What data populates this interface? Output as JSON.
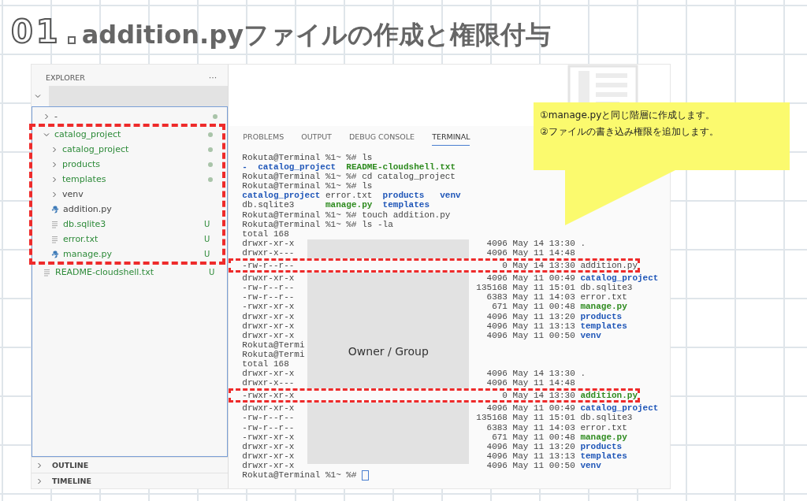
{
  "title": {
    "number": "01",
    "text": "addition.pyファイルの作成と権限付与"
  },
  "explorer": {
    "title": "EXPLORER",
    "more": "···",
    "tree": [
      {
        "name": "-",
        "kind": "folder",
        "expanded": false,
        "untracked": false,
        "dot": true
      },
      {
        "name": "catalog_project",
        "kind": "folder",
        "expanded": true,
        "untracked": true,
        "dot": true,
        "highlighted": true,
        "children": [
          {
            "name": "catalog_project",
            "kind": "folder",
            "expanded": false,
            "untracked": true,
            "dot": true
          },
          {
            "name": "products",
            "kind": "folder",
            "expanded": false,
            "untracked": true,
            "dot": true
          },
          {
            "name": "templates",
            "kind": "folder",
            "expanded": false,
            "untracked": true,
            "dot": true
          },
          {
            "name": "venv",
            "kind": "folder",
            "expanded": false,
            "untracked": false,
            "dot": false
          },
          {
            "name": "addition.py",
            "kind": "python",
            "untracked": false,
            "dot": false
          },
          {
            "name": "db.sqlite3",
            "kind": "text",
            "untracked": true,
            "dot": false,
            "badge": "U"
          },
          {
            "name": "error.txt",
            "kind": "text",
            "untracked": true,
            "dot": false,
            "badge": "U"
          },
          {
            "name": "manage.py",
            "kind": "python",
            "untracked": true,
            "dot": false,
            "badge": "U"
          }
        ]
      },
      {
        "name": "README-cloudshell.txt",
        "kind": "text",
        "untracked": true,
        "dot": false,
        "badge": "U"
      }
    ],
    "sections": [
      {
        "label": "OUTLINE",
        "expanded": false
      },
      {
        "label": "TIMELINE",
        "expanded": false
      }
    ]
  },
  "panel_tabs": [
    {
      "label": "PROBLEMS",
      "selected": false
    },
    {
      "label": "OUTPUT",
      "selected": false
    },
    {
      "label": "DEBUG CONSOLE",
      "selected": false
    },
    {
      "label": "TERMINAL",
      "selected": true
    }
  ],
  "terminal": {
    "lines": [
      {
        "kind": "text",
        "segments": [
          {
            "text": "Rokuta@Terminal %1~ %# ls",
            "color": "#444444"
          }
        ]
      },
      {
        "kind": "text",
        "segments": [
          {
            "text": "-  catalog_project",
            "color": "#1f56b8"
          },
          {
            "text": "  README-cloudshell.txt",
            "color": "#2e8b1f"
          }
        ]
      },
      {
        "kind": "text",
        "segments": [
          {
            "text": "Rokuta@Terminal %1~ %# cd catalog_project",
            "color": "#444444"
          }
        ]
      },
      {
        "kind": "text",
        "segments": [
          {
            "text": "Rokuta@Terminal %1~ %# ls",
            "color": "#444444"
          }
        ]
      },
      {
        "kind": "text",
        "segments": [
          {
            "text": "catalog_project",
            "color": "#1f56b8"
          },
          {
            "text": " error.txt ",
            "color": "#444444"
          },
          {
            "text": " products   venv",
            "color": "#1f56b8"
          }
        ]
      },
      {
        "kind": "text",
        "segments": [
          {
            "text": "db.sqlite3      ",
            "color": "#444444"
          },
          {
            "text": "manage.py",
            "color": "#2e8b1f"
          },
          {
            "text": "  templates",
            "color": "#1f56b8"
          }
        ]
      },
      {
        "kind": "text",
        "segments": [
          {
            "text": "Rokuta@Terminal %1~ %# touch addition.py",
            "color": "#444444"
          }
        ]
      },
      {
        "kind": "text",
        "segments": [
          {
            "text": "Rokuta@Terminal %1~ %# ls -la",
            "color": "#444444"
          }
        ]
      },
      {
        "kind": "text",
        "segments": [
          {
            "text": "total 168",
            "color": "#444444"
          }
        ]
      },
      {
        "kind": "entry",
        "perms": "drwxr-xr-x",
        "meta": "4096 May 14 13:30",
        "name": "."
      },
      {
        "kind": "entry",
        "perms": "drwxr-x---",
        "meta": "4096 May 11 14:48"
      },
      {
        "kind": "entry",
        "perms": "-rw-r--r--",
        "meta": "0 May 14 13:30",
        "name": "addition.py",
        "color": "#444444",
        "highlighted": true
      },
      {
        "kind": "entry",
        "perms": "drwxr-xr-x",
        "meta": "4096 May 11 00:49",
        "name": "catalog_project",
        "color": "#1f56b8"
      },
      {
        "kind": "entry",
        "perms": "-rw-r--r--",
        "meta": "135168 May 11 15:01",
        "name": "db.sqlite3",
        "color": "#444444"
      },
      {
        "kind": "entry",
        "perms": "-rw-r--r--",
        "meta": "6383 May 11 14:03",
        "name": "error.txt",
        "color": "#444444"
      },
      {
        "kind": "entry",
        "perms": "-rwxr-xr-x",
        "meta": "671 May 11 00:48",
        "name": "manage.py",
        "color": "#2e8b1f"
      },
      {
        "kind": "entry",
        "perms": "drwxr-xr-x",
        "meta": "4096 May 11 13:20",
        "name": "products",
        "color": "#1f56b8"
      },
      {
        "kind": "entry",
        "perms": "drwxr-xr-x",
        "meta": "4096 May 11 13:13",
        "name": "templates",
        "color": "#1f56b8"
      },
      {
        "kind": "entry",
        "perms": "drwxr-xr-x",
        "meta": "4096 May 11 00:50",
        "name": "venv",
        "color": "#1f56b8"
      },
      {
        "kind": "text",
        "segments": [
          {
            "text": "Rokuta@Termi",
            "color": "#444444"
          }
        ]
      },
      {
        "kind": "text",
        "segments": [
          {
            "text": "Rokuta@Termi",
            "color": "#444444"
          }
        ]
      },
      {
        "kind": "text",
        "segments": [
          {
            "text": "total 168",
            "color": "#444444"
          }
        ]
      },
      {
        "kind": "entry",
        "perms": "drwxr-xr-x",
        "meta": "4096 May 14 13:30",
        "name": "."
      },
      {
        "kind": "entry",
        "perms": "drwxr-x---",
        "meta": "4096 May 11 14:48"
      },
      {
        "kind": "entry",
        "perms": "-rwxr-xr-x",
        "meta": "0 May 14 13:30",
        "name": "addition.py",
        "color": "#2e8b1f",
        "highlighted": true
      },
      {
        "kind": "entry",
        "perms": "drwxr-xr-x",
        "meta": "4096 May 11 00:49",
        "name": "catalog_project",
        "color": "#1f56b8"
      },
      {
        "kind": "entry",
        "perms": "-rw-r--r--",
        "meta": "135168 May 11 15:01",
        "name": "db.sqlite3",
        "color": "#444444"
      },
      {
        "kind": "entry",
        "perms": "-rw-r--r--",
        "meta": "6383 May 11 14:03",
        "name": "error.txt",
        "color": "#444444"
      },
      {
        "kind": "entry",
        "perms": "-rwxr-xr-x",
        "meta": "671 May 11 00:48",
        "name": "manage.py",
        "color": "#2e8b1f"
      },
      {
        "kind": "entry",
        "perms": "drwxr-xr-x",
        "meta": "4096 May 11 13:20",
        "name": "products",
        "color": "#1f56b8"
      },
      {
        "kind": "entry",
        "perms": "drwxr-xr-x",
        "meta": "4096 May 11 13:13",
        "name": "templates",
        "color": "#1f56b8"
      },
      {
        "kind": "entry",
        "perms": "drwxr-xr-x",
        "meta": "4096 May 11 00:50",
        "name": "venv",
        "color": "#1f56b8"
      },
      {
        "kind": "prompt",
        "segments": [
          {
            "text": "Rokuta@Terminal %1~ %# ",
            "color": "#444444"
          }
        ]
      }
    ],
    "overlay": "Owner / Group"
  },
  "callout": [
    "①manage.pyと同じ階層に作成します。",
    "②ファイルの書き込み権限を追加します。"
  ]
}
